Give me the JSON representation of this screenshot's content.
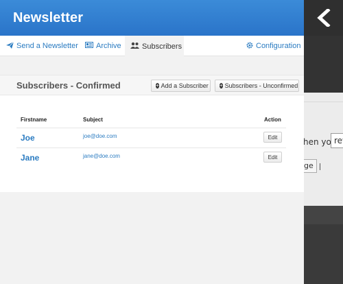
{
  "header": {
    "title": "Newsletter"
  },
  "tabs": [
    {
      "label": "Send a Newsletter",
      "icon": "paper-plane-icon"
    },
    {
      "label": "Archive",
      "icon": "newspaper-icon"
    },
    {
      "label": "Subscribers",
      "icon": "users-icon",
      "active": true
    },
    {
      "label": "Configuration",
      "icon": "gear-icon"
    }
  ],
  "section": {
    "title": "Subscribers - Confirmed",
    "add_button": "Add a Subscriber",
    "unconfirmed_button": "Subscribers - Unconfirmed"
  },
  "table": {
    "headers": {
      "firstname": "Firstname",
      "subject": "Subject",
      "action": "Action"
    },
    "rows": [
      {
        "firstname": "Joe",
        "email": "joe@doe.com",
        "action": "Edit"
      },
      {
        "firstname": "Jane",
        "email": "jane@doe.com",
        "action": "Edit"
      }
    ]
  },
  "background_page": {
    "text": "hen you",
    "input_value": "rev",
    "button_label": "ge"
  },
  "colors": {
    "accent": "#2a7bc1",
    "header": "#2f7fd1"
  }
}
